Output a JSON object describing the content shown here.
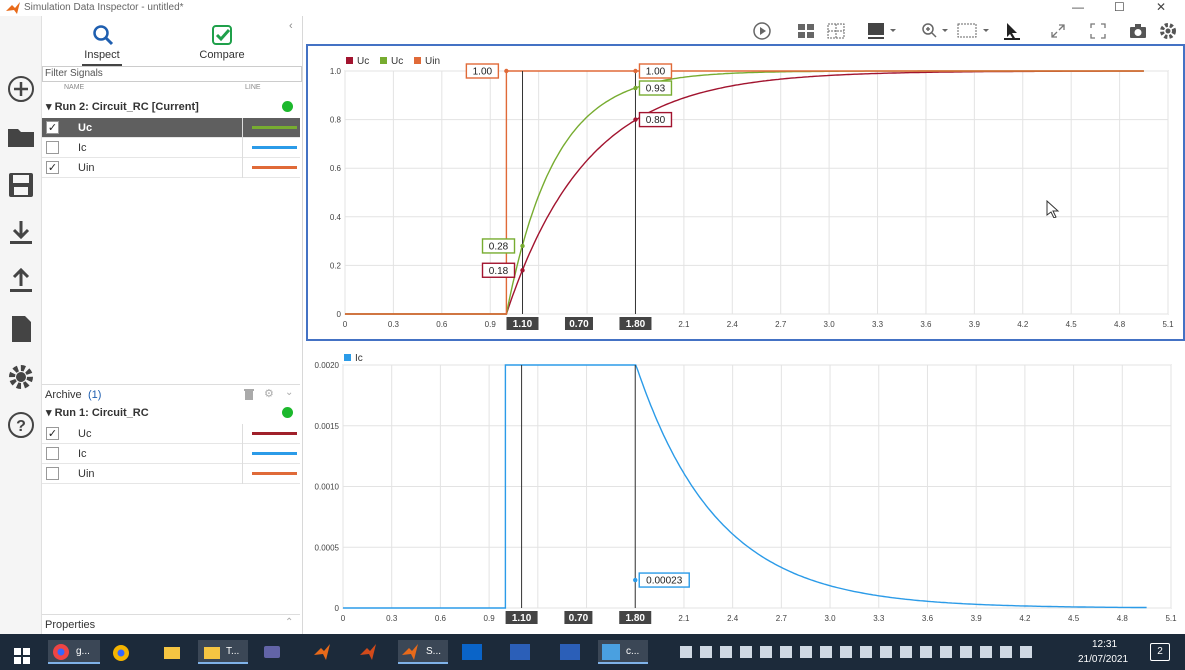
{
  "window": {
    "title": "Simulation Data Inspector - untitled*",
    "minimize": "—",
    "maximize": "☐",
    "close": "✕"
  },
  "tabs": {
    "inspect": "Inspect",
    "compare": "Compare"
  },
  "filter_placeholder": "Filter Signals",
  "columns": {
    "name": "NAME",
    "line": "LINE"
  },
  "current_run": {
    "label": "Run 2: Circuit_RC [Current]",
    "signals": [
      {
        "name": "Uc",
        "checked": "✓",
        "color": "#77ac30",
        "selected": true
      },
      {
        "name": "Ic",
        "checked": "",
        "color": "#2b9be8",
        "selected": false
      },
      {
        "name": "Uin",
        "checked": "✓",
        "color": "#e06a38",
        "selected": false
      }
    ]
  },
  "archive": {
    "label": "Archive",
    "count": "(1)"
  },
  "archived_run": {
    "label": "Run 1: Circuit_RC",
    "signals": [
      {
        "name": "Uc",
        "checked": "✓",
        "color": "#a0202a"
      },
      {
        "name": "Ic",
        "checked": "",
        "color": "#2b9be8"
      },
      {
        "name": "Uin",
        "checked": "",
        "color": "#e06a38"
      }
    ]
  },
  "properties_label": "Properties",
  "colors": {
    "uc_run1": "#a2142f",
    "uc_run2": "#77ac30",
    "uin": "#e06a38",
    "ic": "#2b9be8",
    "cursor": "#333333",
    "plot_border": "#4472c4"
  },
  "chart_data": [
    {
      "type": "line",
      "legend": [
        "Uc",
        "Uc",
        "Uin"
      ],
      "legend_colors": [
        "#a2142f",
        "#77ac30",
        "#e06a38"
      ],
      "xlim": [
        0,
        5.1
      ],
      "ylim": [
        0,
        1.0
      ],
      "xticks": [
        0,
        0.3,
        0.6,
        0.9,
        1.2,
        1.5,
        1.8,
        2.1,
        2.4,
        2.7,
        3.0,
        3.3,
        3.6,
        3.9,
        4.2,
        4.5,
        4.8,
        5.1
      ],
      "xtick_labels": [
        "0",
        "0.3",
        "0.6",
        "0.9",
        "",
        "",
        "",
        "2.1",
        "2.4",
        "2.7",
        "3.0",
        "3.3",
        "3.6",
        "3.9",
        "4.2",
        "4.5",
        "4.8",
        "5.1"
      ],
      "yticks": [
        0,
        0.2,
        0.4,
        0.6,
        0.8,
        1.0
      ],
      "ytick_labels": [
        "0",
        "0.2",
        "0.4",
        "0.6",
        "0.8",
        "1.0"
      ],
      "series": [
        {
          "name": "Uc",
          "color": "#a2142f",
          "tau": 0.5,
          "t0": 1.0
        },
        {
          "name": "Uc",
          "color": "#77ac30",
          "tau": 0.3,
          "t0": 1.0
        },
        {
          "name": "Uin",
          "color": "#e06a38",
          "step_at": 1.0
        }
      ],
      "cursors": [
        1.1,
        1.8
      ],
      "cursor_labels": [
        "1.10",
        "0.70",
        "1.80"
      ],
      "data_labels": [
        {
          "text": "1.00",
          "x": 1.0,
          "y": 1.0,
          "color": "#e06a38",
          "side": "left"
        },
        {
          "text": "1.00",
          "x": 1.8,
          "y": 1.0,
          "color": "#e06a38",
          "side": "right"
        },
        {
          "text": "0.93",
          "x": 1.8,
          "y": 0.93,
          "color": "#77ac30",
          "side": "right"
        },
        {
          "text": "0.80",
          "x": 1.8,
          "y": 0.8,
          "color": "#a2142f",
          "side": "right"
        },
        {
          "text": "0.28",
          "x": 1.1,
          "y": 0.28,
          "color": "#77ac30",
          "side": "left"
        },
        {
          "text": "0.18",
          "x": 1.1,
          "y": 0.18,
          "color": "#a2142f",
          "side": "left"
        }
      ]
    },
    {
      "type": "line",
      "legend": [
        "Ic"
      ],
      "legend_colors": [
        "#2b9be8"
      ],
      "xlim": [
        0,
        5.1
      ],
      "ylim": [
        0,
        0.002
      ],
      "xticks": [
        0,
        0.3,
        0.6,
        0.9,
        1.2,
        1.5,
        1.8,
        2.1,
        2.4,
        2.7,
        3.0,
        3.3,
        3.6,
        3.9,
        4.2,
        4.5,
        4.8,
        5.1
      ],
      "xtick_labels": [
        "0",
        "0.3",
        "0.6",
        "0.9",
        "",
        "",
        "",
        "2.1",
        "2.4",
        "2.7",
        "3.0",
        "3.3",
        "3.6",
        "3.9",
        "4.2",
        "4.5",
        "4.8",
        "5.1"
      ],
      "yticks": [
        0,
        0.0005,
        0.001,
        0.0015,
        0.002
      ],
      "ytick_labels": [
        "0",
        "0.0005",
        "0.0010",
        "0.0015",
        "0.0020"
      ],
      "series": [
        {
          "name": "Ic",
          "color": "#2b9be8",
          "peak": 0.01,
          "tau": 0.5,
          "t0": 1.0
        }
      ],
      "cursors": [
        1.1,
        1.8
      ],
      "cursor_labels": [
        "1.10",
        "0.70",
        "1.80"
      ],
      "data_labels": [
        {
          "text": "0.00023",
          "x": 1.8,
          "y": 0.00023,
          "color": "#2b9be8",
          "side": "right"
        }
      ]
    }
  ],
  "taskbar": {
    "apps": [
      "g...",
      "T...",
      "S...",
      "c..."
    ],
    "time": "12:31",
    "date": "21/07/2021",
    "notif": "2"
  }
}
